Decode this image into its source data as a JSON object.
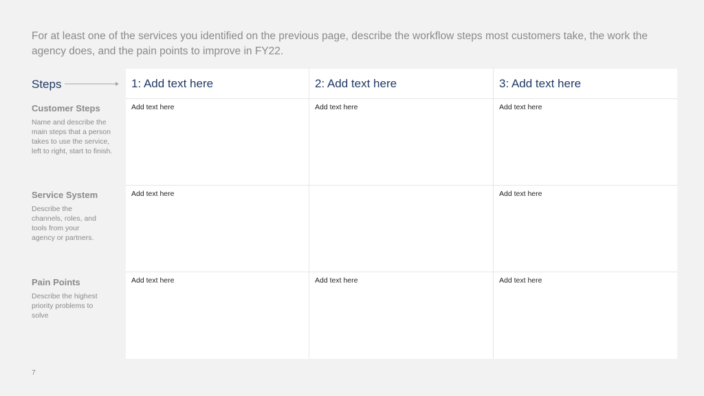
{
  "intro": "For at least one of the services you identified on the previous page, describe the workflow steps most customers take, the work the agency does, and the pain points to improve in FY22.",
  "steps_label": "Steps",
  "rows": [
    {
      "title": "Customer Steps",
      "desc": "Name and describe the main steps that a person takes to use the service, left to right, start to finish."
    },
    {
      "title": "Service System",
      "desc": "Describe the channels, roles, and tools from your agency or partners."
    },
    {
      "title": "Pain Points",
      "desc": "Describe the highest priority problems to solve"
    }
  ],
  "columns": [
    "1: Add text here",
    "2: Add text here",
    "3: Add text here"
  ],
  "cells": [
    [
      "Add text here",
      "Add text here",
      "Add text here"
    ],
    [
      "Add text here",
      "",
      "Add text here"
    ],
    [
      "Add text here",
      "Add text here",
      "Add text here"
    ]
  ],
  "page_number": "7"
}
